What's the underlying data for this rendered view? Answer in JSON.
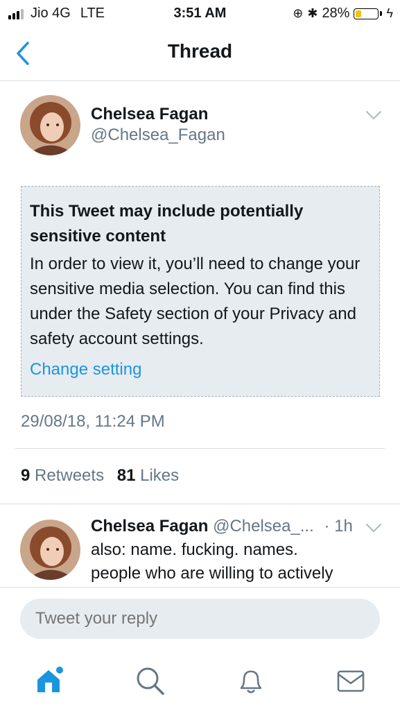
{
  "status": {
    "carrier": "Jio 4G",
    "network": "LTE",
    "time": "3:51 AM",
    "battery": "28%",
    "battery_level": 0.28
  },
  "nav": {
    "title": "Thread"
  },
  "tweet": {
    "author_name": "Chelsea Fagan",
    "author_handle": "@Chelsea_Fagan",
    "warning_title": "This Tweet may include potentially sensitive content",
    "warning_body": "In order to view it, you’ll need to change your sensitive media selection. You can find this under the Safety section of your Privacy and safety account settings.",
    "warning_link": "Change setting",
    "timestamp": "29/08/18, 11:24 PM",
    "retweets_count": "9",
    "retweets_label": "Retweets",
    "likes_count": "81",
    "likes_label": "Likes"
  },
  "reply": {
    "author_name": "Chelsea Fagan",
    "author_handle": "@Chelsea_...",
    "age": "· 1h",
    "line1": "also: name. fucking. names.",
    "line2": "people who are willing to actively"
  },
  "composer": {
    "placeholder": "Tweet your reply"
  },
  "colors": {
    "accent": "#1b95e0",
    "secondary_text": "#657786",
    "sensitive_bg": "#e6ecf0"
  },
  "tabbar": [
    "home-icon",
    "search-icon",
    "notifications-icon",
    "messages-icon"
  ]
}
